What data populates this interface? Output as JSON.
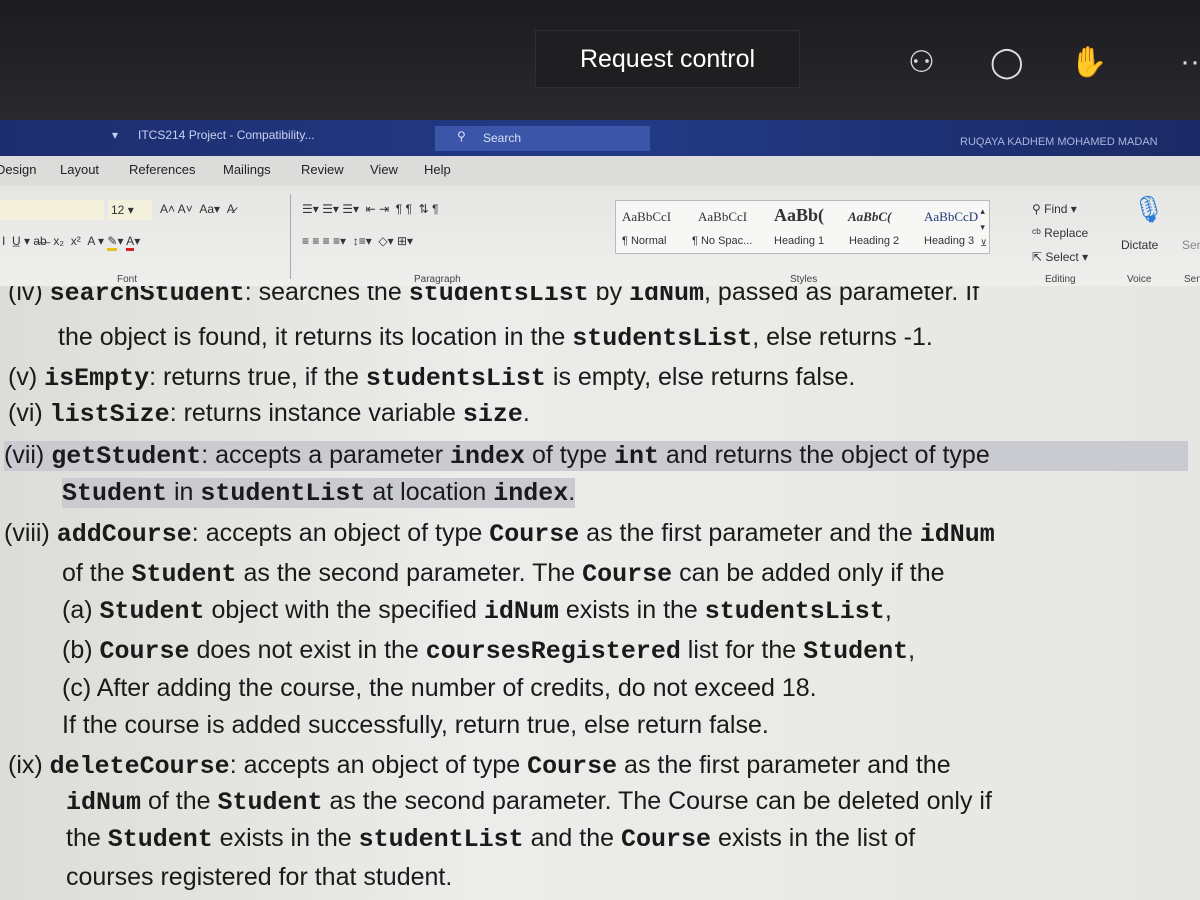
{
  "meeting": {
    "request_control": "Request control",
    "icons": [
      "participants-icon",
      "chat-icon",
      "reactions-icon",
      "more-icon"
    ]
  },
  "titlebar": {
    "doc_title": "ITCS214 Project  -  Compatibility...",
    "search": "Search",
    "user": "RUQAYA KADHEM MOHAMED MADAN"
  },
  "tabs": [
    "Design",
    "Layout",
    "References",
    "Mailings",
    "Review",
    "View",
    "Help"
  ],
  "ribbon": {
    "font_size": "12",
    "groups": {
      "font": "Font",
      "paragraph": "Paragraph",
      "styles": "Styles",
      "editing": "Editing",
      "voice": "Voice",
      "sensitivity": "Sen"
    },
    "styles": [
      {
        "sample": "AaBbCcI",
        "label": "¶ Normal"
      },
      {
        "sample": "AaBbCcI",
        "label": "¶ No Spac..."
      },
      {
        "sample": "AaBb(",
        "label": "Heading 1"
      },
      {
        "sample": "AaBbC(",
        "label": "Heading 2"
      },
      {
        "sample": "AaBbCcD",
        "label": "Heading 3"
      }
    ],
    "editing": {
      "find": "Find",
      "replace": "Replace",
      "select": "Select"
    },
    "dictate": "Dictate",
    "sen": "Sen"
  },
  "document": {
    "lines": [
      [
        {
          "t": "(iv) "
        },
        {
          "t": "searchStudent",
          "c": 1
        },
        {
          "t": ": searches the "
        },
        {
          "t": "studentsList",
          "c": 1
        },
        {
          "t": " by "
        },
        {
          "t": "idNum",
          "c": 1
        },
        {
          "t": ", passed as parameter. If"
        }
      ],
      [
        {
          "t": "the object is found, it returns its location in the "
        },
        {
          "t": "studentsList",
          "c": 1
        },
        {
          "t": ", else returns -1."
        }
      ],
      [
        {
          "t": "(v)  "
        },
        {
          "t": "isEmpty",
          "c": 1
        },
        {
          "t": ": returns true, if the "
        },
        {
          "t": "studentsList",
          "c": 1
        },
        {
          "t": " is empty, else returns false."
        }
      ],
      [
        {
          "t": "(vi) "
        },
        {
          "t": "listSize",
          "c": 1
        },
        {
          "t": ": returns instance variable "
        },
        {
          "t": "size",
          "c": 1
        },
        {
          "t": "."
        }
      ],
      [
        {
          "t": "(vii) "
        },
        {
          "t": "getStudent",
          "c": 1
        },
        {
          "t": ": accepts a parameter "
        },
        {
          "t": "index",
          "c": 1
        },
        {
          "t": " of type "
        },
        {
          "t": "int",
          "c": 1
        },
        {
          "t": " and returns the object of type"
        }
      ],
      [
        {
          "t": "Student",
          "c": 1
        },
        {
          "t": " in "
        },
        {
          "t": "studentList",
          "c": 1
        },
        {
          "t": " at location "
        },
        {
          "t": "index",
          "c": 1
        },
        {
          "t": "."
        }
      ],
      [
        {
          "t": "(viii) "
        },
        {
          "t": "addCourse",
          "c": 1
        },
        {
          "t": ": accepts an object of type "
        },
        {
          "t": "Course",
          "c": 1
        },
        {
          "t": " as the first parameter and the "
        },
        {
          "t": "idNum",
          "c": 1
        }
      ],
      [
        {
          "t": "of the "
        },
        {
          "t": "Student",
          "c": 1
        },
        {
          "t": " as the second parameter. The "
        },
        {
          "t": "Course",
          "c": 1
        },
        {
          "t": " can be added only if the"
        }
      ],
      [
        {
          "t": "(a) "
        },
        {
          "t": "Student",
          "c": 1
        },
        {
          "t": " object with the specified "
        },
        {
          "t": "idNum",
          "c": 1
        },
        {
          "t": " exists in the "
        },
        {
          "t": "studentsList",
          "c": 1
        },
        {
          "t": ","
        }
      ],
      [
        {
          "t": "(b) "
        },
        {
          "t": "Course",
          "c": 1
        },
        {
          "t": " does not exist in the "
        },
        {
          "t": "coursesRegistered",
          "c": 1
        },
        {
          "t": " list for the "
        },
        {
          "t": "Student",
          "c": 1
        },
        {
          "t": ","
        }
      ],
      [
        {
          "t": "(c) After adding the course, the number of credits, do not exceed 18."
        }
      ],
      [
        {
          "t": "If the course is added successfully, return true, else return false."
        }
      ],
      [
        {
          "t": "(ix) "
        },
        {
          "t": "deleteCourse",
          "c": 1
        },
        {
          "t": ": accepts an object of type "
        },
        {
          "t": "Course",
          "c": 1
        },
        {
          "t": " as the first parameter and the"
        }
      ],
      [
        {
          "t": "idNum",
          "c": 1
        },
        {
          "t": " of the "
        },
        {
          "t": "Student",
          "c": 1
        },
        {
          "t": " as the second parameter. The Course can be deleted only if"
        }
      ],
      [
        {
          "t": "the "
        },
        {
          "t": "Student",
          "c": 1
        },
        {
          "t": " exists in the "
        },
        {
          "t": "studentList",
          "c": 1
        },
        {
          "t": " and the "
        },
        {
          "t": "Course",
          "c": 1
        },
        {
          "t": " exists in the list of"
        }
      ],
      [
        {
          "t": "courses registered for that student."
        }
      ]
    ]
  }
}
